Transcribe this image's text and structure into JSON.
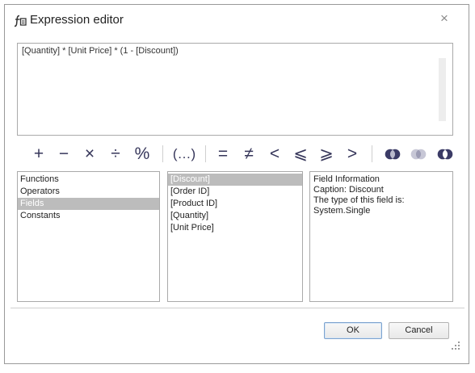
{
  "dialog": {
    "title": "Expression editor",
    "close_glyph": "×"
  },
  "expression": {
    "text": "[Quantity] * [Unit Price] * (1 - [Discount])"
  },
  "toolbar": {
    "plus": "+",
    "minus": "−",
    "multiply": "×",
    "divide": "÷",
    "modulo": "%",
    "parentheses": "(…)",
    "equal": "=",
    "not_equal": "≠",
    "less": "<",
    "less_equal": "⩽",
    "greater_equal": "⩾",
    "greater": ">",
    "circle_colors": {
      "dark": "#3b3b66",
      "light": "#b9b9cc"
    }
  },
  "categories": {
    "items": [
      {
        "label": "Functions",
        "selected": false
      },
      {
        "label": "Operators",
        "selected": false
      },
      {
        "label": "Fields",
        "selected": true
      },
      {
        "label": "Constants",
        "selected": false
      }
    ]
  },
  "fields": {
    "items": [
      {
        "label": "[Discount]",
        "selected": true
      },
      {
        "label": "[Order ID]",
        "selected": false
      },
      {
        "label": "[Product ID]",
        "selected": false
      },
      {
        "label": "[Quantity]",
        "selected": false
      },
      {
        "label": "[Unit Price]",
        "selected": false
      }
    ]
  },
  "info": {
    "heading": "Field Information",
    "caption": "Caption: Discount",
    "type_line": "The type of this field is:",
    "type_value": "System.Single"
  },
  "buttons": {
    "ok": "OK",
    "cancel": "Cancel"
  }
}
